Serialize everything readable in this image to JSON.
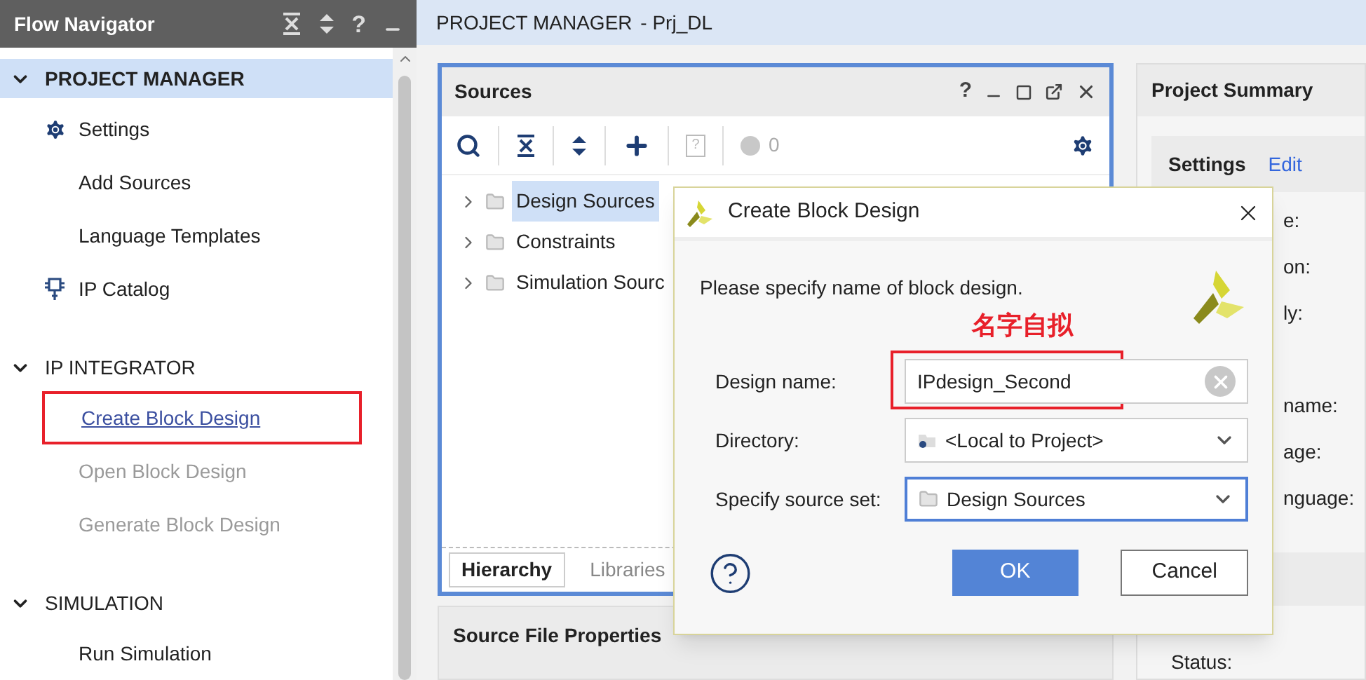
{
  "flow_navigator": {
    "title": "Flow Navigator",
    "help": "?",
    "sections": [
      {
        "label": "PROJECT MANAGER",
        "expanded": true,
        "selected": true,
        "items": [
          {
            "label": "Settings",
            "kind": "settings",
            "disabled": false,
            "highlighted": false
          },
          {
            "label": "Add Sources",
            "kind": "plain",
            "disabled": false,
            "highlighted": false
          },
          {
            "label": "Language Templates",
            "kind": "plain",
            "disabled": false,
            "highlighted": false
          },
          {
            "label": "IP Catalog",
            "kind": "catalog",
            "disabled": false,
            "highlighted": false
          }
        ]
      },
      {
        "label": "IP INTEGRATOR",
        "expanded": true,
        "selected": false,
        "items": [
          {
            "label": "Create Block Design",
            "kind": "plain",
            "disabled": false,
            "highlighted": true
          },
          {
            "label": "Open Block Design",
            "kind": "plain",
            "disabled": true,
            "highlighted": false
          },
          {
            "label": "Generate Block Design",
            "kind": "plain",
            "disabled": true,
            "highlighted": false
          }
        ]
      },
      {
        "label": "SIMULATION",
        "expanded": true,
        "selected": false,
        "items": [
          {
            "label": "Run Simulation",
            "kind": "plain",
            "disabled": false,
            "highlighted": false
          }
        ]
      }
    ]
  },
  "main_header": {
    "title": "PROJECT MANAGER",
    "project": " - Prj_DL"
  },
  "sources": {
    "title": "Sources",
    "help": "?",
    "info": "?",
    "count": "0",
    "tree": [
      {
        "label": "Design Sources",
        "selected": true
      },
      {
        "label": "Constraints",
        "selected": false
      },
      {
        "label": "Simulation Sourc",
        "selected": false
      }
    ],
    "tabs": [
      {
        "label": "Hierarchy",
        "selected": true
      },
      {
        "label": "Libraries",
        "selected": false
      }
    ]
  },
  "source_file_properties": {
    "title": "Source File Properties"
  },
  "project_summary": {
    "title": "Project Summary",
    "settings_title": "Settings",
    "edit_link": "Edit",
    "label_groups": [
      [
        "e:",
        "on:",
        "ly:"
      ],
      [
        "name:",
        "age:",
        "nguage:"
      ]
    ],
    "status_label": "Status:"
  },
  "dialog": {
    "title": "Create Block Design",
    "message": "Please specify name of block design.",
    "annotation": "名字自拟",
    "fields": [
      {
        "label": "Design name:",
        "kind": "text",
        "value": "IPdesign_Second",
        "focused": false,
        "highlighted": true
      },
      {
        "label": "Directory:",
        "kind": "directory",
        "value": "<Local to Project>",
        "focused": false,
        "highlighted": false
      },
      {
        "label": "Specify source set:",
        "kind": "folder",
        "value": "Design Sources",
        "focused": true,
        "highlighted": false
      }
    ],
    "buttons": [
      {
        "label": "OK",
        "primary": true
      },
      {
        "label": "Cancel",
        "primary": false
      }
    ]
  }
}
